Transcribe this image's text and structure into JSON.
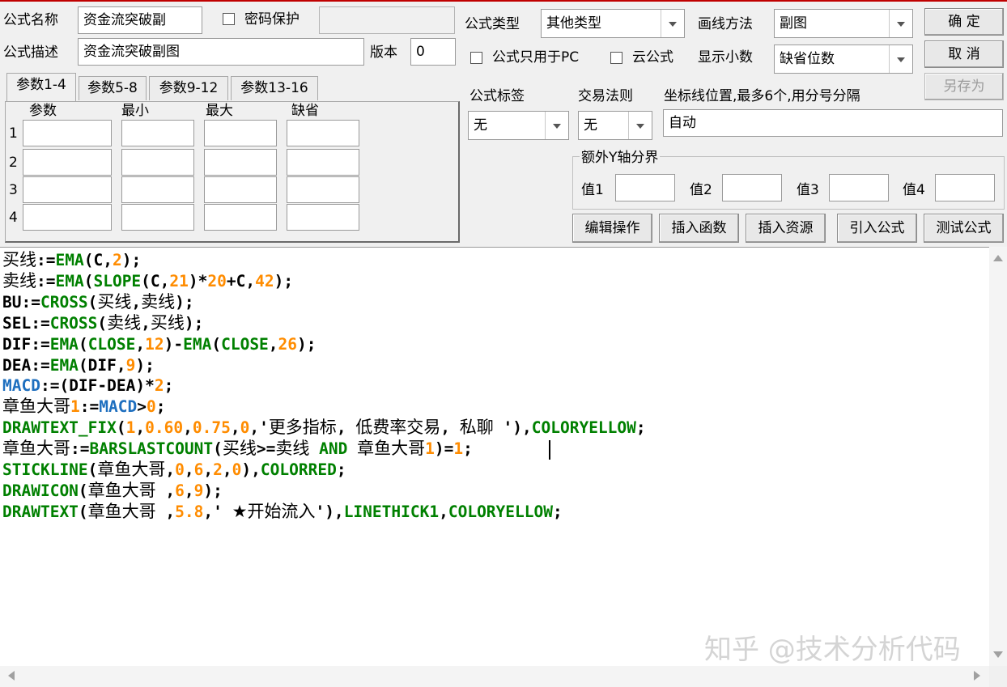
{
  "header": {
    "name_label": "公式名称",
    "name_value": "资金流突破副",
    "password_label": "密码保护",
    "desc_label": "公式描述",
    "desc_value": "资金流突破副图",
    "version_label": "版本",
    "version_value": "0",
    "type_label": "公式类型",
    "type_value": "其他类型",
    "draw_label": "画线方法",
    "draw_value": "副图",
    "pc_only_label": "公式只用于PC",
    "cloud_label": "云公式",
    "decimals_label": "显示小数",
    "decimals_value": "缺省位数"
  },
  "buttons": {
    "ok": "确  定",
    "cancel": "取  消",
    "save_as": "另存为",
    "edit_ops": "编辑操作",
    "insert_func": "插入函数",
    "insert_res": "插入资源",
    "import_formula": "引入公式",
    "test_formula": "测试公式"
  },
  "params": {
    "tabs": [
      "参数1-4",
      "参数5-8",
      "参数9-12",
      "参数13-16"
    ],
    "headers": [
      "参数",
      "最小",
      "最大",
      "缺省"
    ],
    "rows": [
      "1",
      "2",
      "3",
      "4"
    ]
  },
  "options": {
    "tag_label": "公式标签",
    "tag_value": "无",
    "rule_label": "交易法则",
    "rule_value": "无",
    "coord_label": "坐标线位置,最多6个,用分号分隔",
    "coord_value": "自动",
    "yaxis_label": "额外Y轴分界",
    "val1": "值1",
    "val2": "值2",
    "val3": "值3",
    "val4": "值4"
  },
  "code_lines": [
    "买线:=EMA(C,2);",
    "卖线:=EMA(SLOPE(C,21)*20+C,42);",
    "BU:=CROSS(买线,卖线);",
    "SEL:=CROSS(卖线,买线);",
    "DIF:=EMA(CLOSE,12)-EMA(CLOSE,26);",
    "DEA:=EMA(DIF,9);",
    "MACD:=(DIF-DEA)*2;",
    "章鱼大哥1:=MACD>0;",
    "DRAWTEXT_FIX(1,0.60,0.75,0,'更多指标, 低费率交易, 私聊 '),COLORYELLOW;",
    "章鱼大哥:=BARSLASTCOUNT(买线>=卖线 AND 章鱼大哥1)=1;",
    "STICKLINE(章鱼大哥,0,6,2,0),COLORRED;",
    "DRAWICON(章鱼大哥 ,6,9);",
    "DRAWTEXT(章鱼大哥 ,5.8,' ★开始流入'),LINETHICK1,COLORYELLOW;"
  ],
  "watermark": "知乎 @技术分析代码",
  "colors": {
    "function": "#008000",
    "number": "#ff8c00",
    "macd": "#1e6fbf",
    "top_border": "#c00000"
  }
}
